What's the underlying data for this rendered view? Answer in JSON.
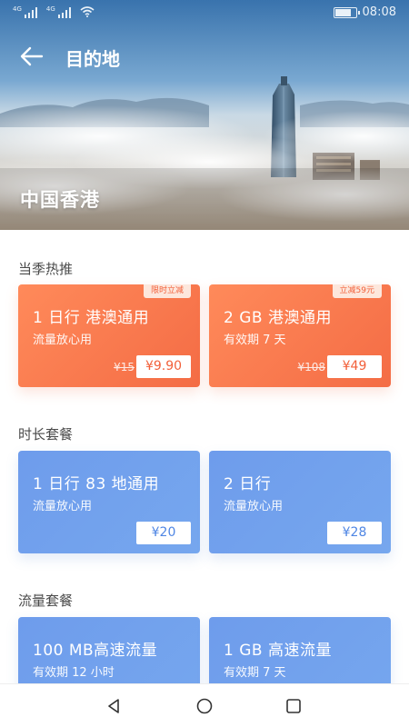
{
  "status_bar": {
    "network_1": "4G",
    "network_2": "4G",
    "time": "08:08",
    "battery_level": 0.85
  },
  "nav": {
    "back_icon": "arrow-left-icon",
    "title": "目的地"
  },
  "hero": {
    "destination": "中国香港"
  },
  "sections": {
    "hot": {
      "title": "当季热推",
      "cards": [
        {
          "name": "1 日行  港澳通用",
          "subtitle": "流量放心用",
          "original_price": "¥15",
          "price": "¥9.90",
          "tag": "限时立减"
        },
        {
          "name": "2 GB 港澳通用",
          "subtitle": "有效期 7 天",
          "original_price": "¥108",
          "price": "¥49",
          "tag": "立减59元"
        }
      ]
    },
    "duration": {
      "title": "时长套餐",
      "cards": [
        {
          "name": "1 日行  83 地通用",
          "subtitle": "流量放心用",
          "price": "¥20"
        },
        {
          "name": "2 日行",
          "subtitle": "流量放心用",
          "price": "¥28"
        }
      ]
    },
    "data": {
      "title": "流量套餐",
      "cards": [
        {
          "name": "100 MB高速流量",
          "subtitle": "有效期 12 小时"
        },
        {
          "name": "1 GB 高速流量",
          "subtitle": "有效期 7 天"
        }
      ]
    }
  },
  "system_nav": {
    "back": "triangle-back-icon",
    "home": "circle-home-icon",
    "recents": "square-recents-icon"
  },
  "colors": {
    "accent_orange": "#f46c45",
    "accent_blue": "#6e9cec"
  }
}
